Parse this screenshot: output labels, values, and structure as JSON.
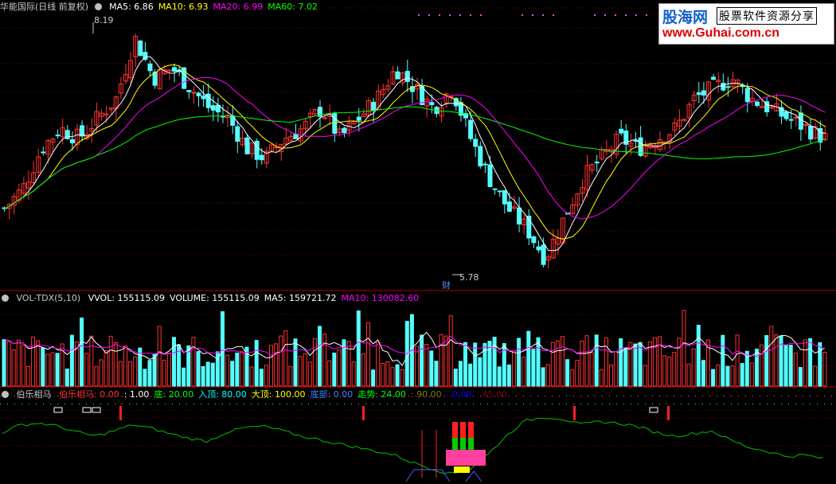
{
  "main_panel": {
    "stock_name": "华能国际(日线 前复权)",
    "ma_values": [
      {
        "label": "MA5: 6.86",
        "color": "#ffffff"
      },
      {
        "label": "MA10: 6.93",
        "color": "#ffff00"
      },
      {
        "label": "MA20: 6.99",
        "color": "#ff00ff"
      },
      {
        "label": "MA60: 7.02",
        "color": "#00ff00"
      }
    ],
    "high_label": "8.19",
    "low_label": "5.78",
    "event_marker": "财"
  },
  "volume_panel": {
    "indicator": "VOL-TDX(5,10)",
    "values": [
      {
        "label": "VVOL: 155115.09",
        "color": "#ffffff"
      },
      {
        "label": "VOLUME: 155115.09",
        "color": "#ffffff"
      },
      {
        "label": "MA5: 159721.72",
        "color": "#ffffff"
      },
      {
        "label": "MA10: 130082.60",
        "color": "#ff00ff"
      }
    ]
  },
  "indicator_panel": {
    "name": "伯乐相马",
    "values": [
      {
        "label": "伯乐相马: 0.00",
        "color": "#ff3030"
      },
      {
        "label": ": 1.00",
        "color": "#ffffff"
      },
      {
        "label": "底: 20.00",
        "color": "#00ff00"
      },
      {
        "label": "入顶: 80.00",
        "color": "#00ffff"
      },
      {
        "label": "大顶: 100.00",
        "color": "#ffff00"
      },
      {
        "label": "底部: 0.00",
        "color": "#4080ff"
      },
      {
        "label": "走势: 24.00",
        "color": "#00ff00"
      },
      {
        "label": ": 90.00",
        "color": "#808000"
      },
      {
        "label": ": 0.00",
        "color": "#0000ff"
      },
      {
        "label": ": 45.00",
        "color": "#800000"
      }
    ]
  },
  "watermark": {
    "brand": "股海网",
    "slogan": "股票软件资源分享",
    "url": "www.Guhai.com.cn"
  },
  "colors": {
    "up": "#ff3232",
    "down": "#54ffff",
    "ma5": "#ffffff",
    "ma10": "#ffff00",
    "ma20": "#ff00ff",
    "ma60": "#00ff00",
    "grid": "#800000"
  },
  "chart_data": {
    "type": "candlestick",
    "price_range": [
      5.6,
      8.3
    ],
    "high": 8.19,
    "low": 5.78,
    "close_path": [
      6.3,
      6.5,
      6.9,
      7.1,
      7.0,
      7.2,
      7.4,
      8.0,
      7.6,
      7.7,
      7.5,
      7.3,
      7.2,
      6.9,
      6.8,
      7.0,
      7.1,
      7.3,
      7.0,
      7.2,
      7.4,
      7.7,
      7.5,
      7.3,
      7.5,
      7.0,
      6.6,
      6.3,
      6.1,
      5.8,
      6.2,
      6.6,
      6.8,
      7.0,
      6.9,
      7.0,
      7.1,
      7.4,
      7.5,
      7.6,
      7.4,
      7.3,
      7.2,
      7.1,
      7.0
    ],
    "indicator_line": [
      60,
      70,
      72,
      68,
      60,
      55,
      62,
      70,
      65,
      58,
      52,
      48,
      60,
      66,
      68,
      62,
      55,
      50,
      45,
      40,
      35,
      30,
      20,
      12,
      5,
      10,
      30,
      55,
      75,
      80,
      78,
      70,
      74,
      72,
      68,
      60,
      55,
      58,
      62,
      50,
      40,
      35,
      28,
      30,
      25
    ]
  }
}
